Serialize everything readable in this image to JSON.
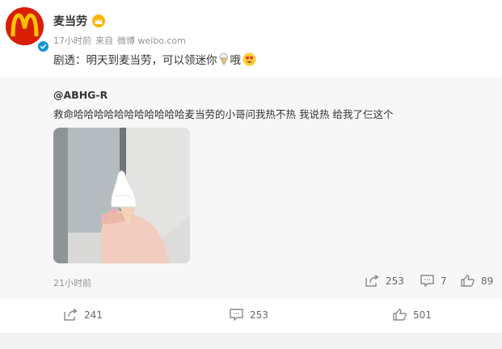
{
  "author": {
    "name": "麦当劳",
    "time": "17小时前",
    "source_prefix": "来自",
    "source": "微博 weibo.com",
    "text": "剧透：明天到麦当劳，可以领迷你",
    "text_suffix": "哦"
  },
  "repost": {
    "user": "@ABHG-R",
    "text": "救命哈哈哈哈哈哈哈哈哈哈哈麦当劳的小哥问我热不热 我说热 给我了仨这个",
    "time": "21小时前",
    "repost_count": "253",
    "comment_count": "7",
    "like_count": "89"
  },
  "footer": {
    "repost_count": "241",
    "comment_count": "253",
    "like_count": "501"
  },
  "colors": {
    "brand_red": "#d81e06",
    "brand_yellow": "#ffc300",
    "verified_blue": "#1296db",
    "muted_text": "#939393",
    "repost_bg": "#f7f7f7"
  },
  "icons": [
    "mcdonalds-logo-icon",
    "verified-icon",
    "crown-badge-icon",
    "ice-cream-emoji-icon",
    "heart-eyes-emoji-icon",
    "repost-icon",
    "comment-icon",
    "like-icon"
  ]
}
